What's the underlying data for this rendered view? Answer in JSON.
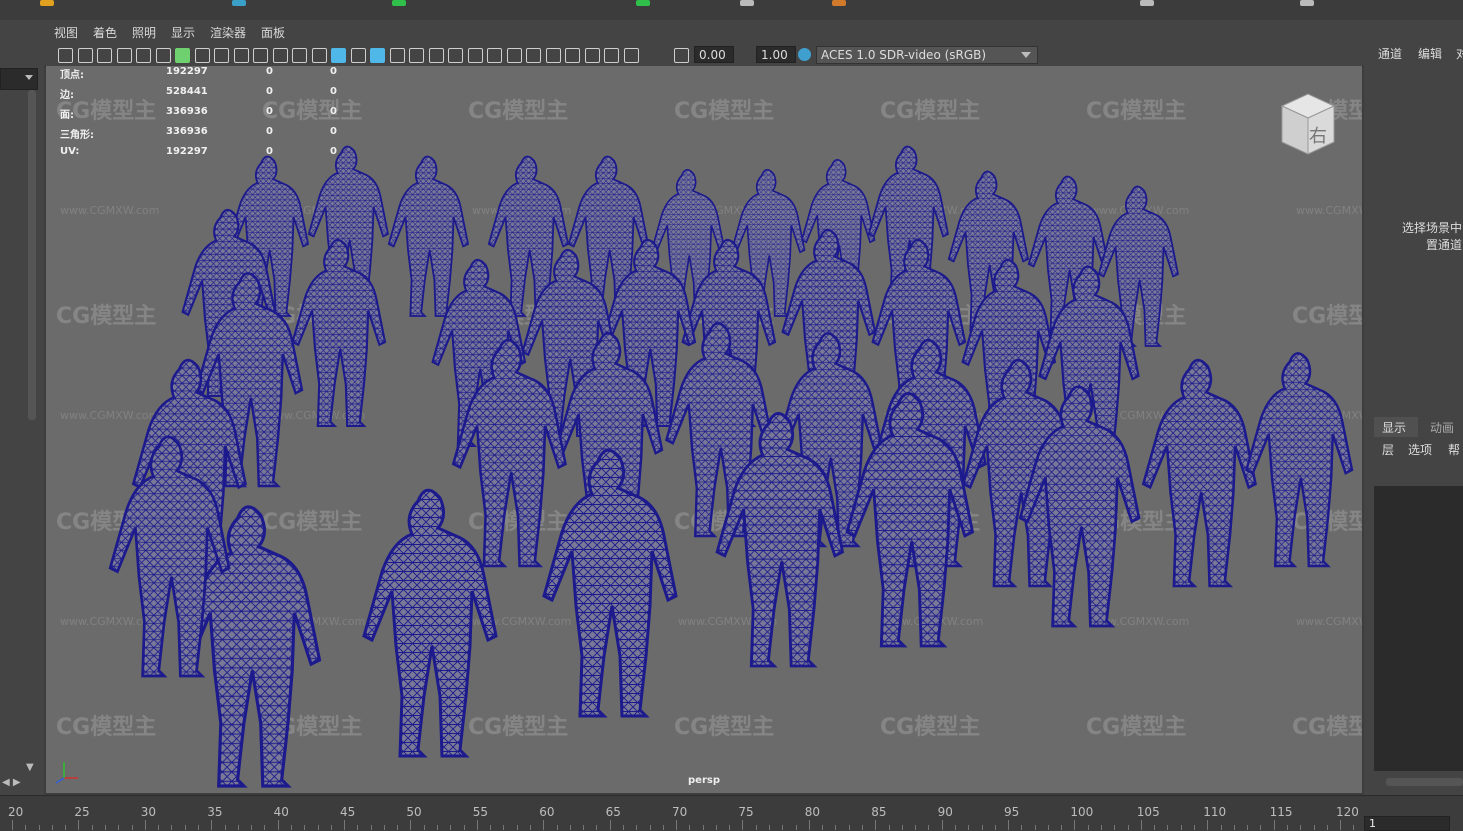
{
  "menu": [
    "视图",
    "着色",
    "照明",
    "显示",
    "渲染器",
    "面板"
  ],
  "toolbar": {
    "field_a": "0.00",
    "field_b": "1.00",
    "color_space": "ACES 1.0 SDR-video (sRGB)"
  },
  "hud": {
    "rows": [
      {
        "label": "顶点:",
        "value": "192297",
        "sel": "0",
        "tris": "0"
      },
      {
        "label": "边:",
        "value": "528441",
        "sel": "0",
        "tris": "0"
      },
      {
        "label": "面:",
        "value": "336936",
        "sel": "0",
        "tris": "0"
      },
      {
        "label": "三角形:",
        "value": "336936",
        "sel": "0",
        "tris": "0"
      },
      {
        "label": "UV:",
        "value": "192297",
        "sel": "0",
        "tris": "0"
      }
    ]
  },
  "viewcube_face": "右",
  "camera_label": "persp",
  "watermark": {
    "brand": "CG模型主",
    "url": "www.CGMXW.com"
  },
  "right_panel": {
    "tabs_top": [
      "通道",
      "编辑",
      "对"
    ],
    "hint_line1": "选择场景中",
    "hint_line2": "置通道",
    "tabs_mid": [
      "显示",
      "动画"
    ],
    "sub_menu": [
      "层",
      "选项",
      "帮"
    ]
  },
  "timeline": {
    "ticks": [
      "20",
      "25",
      "30",
      "35",
      "40",
      "45",
      "50",
      "55",
      "60",
      "65",
      "70",
      "75",
      "80",
      "85",
      "90",
      "95",
      "100",
      "105",
      "110",
      "115",
      "120"
    ],
    "current_frame": "1"
  },
  "colors": {
    "wire": "#1c1a8c",
    "viewport_bg": "#6b6b6b",
    "panel_bg": "#444444"
  }
}
